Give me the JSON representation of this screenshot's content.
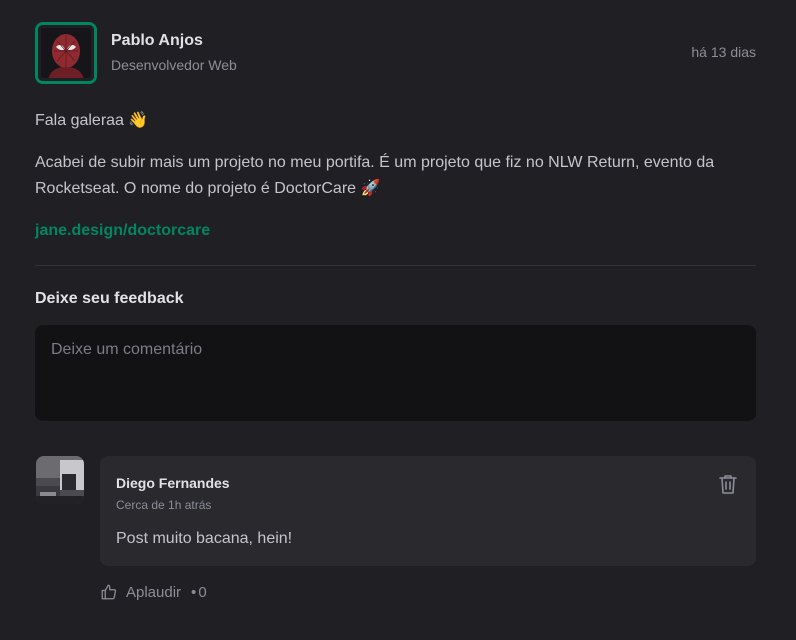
{
  "post": {
    "author": {
      "name": "Pablo Anjos",
      "role": "Desenvolvedor Web"
    },
    "time": "há 13 dias",
    "content": {
      "greeting": "Fala galeraa 👋",
      "body": "Acabei de subir mais um projeto no meu portifa. É um projeto que fiz no NLW Return, evento da Rocketseat. O nome do projeto é DoctorCare 🚀",
      "link": "jane.design/doctorcare"
    }
  },
  "feedback": {
    "title": "Deixe seu feedback",
    "placeholder": "Deixe um comentário"
  },
  "comment": {
    "author": "Diego Fernandes",
    "time": "Cerca de 1h atrás",
    "text": "Post muito bacana, hein!",
    "applaud_label": "Aplaudir",
    "applaud_separator": "•",
    "applaud_count": "0"
  },
  "colors": {
    "background": "#202024",
    "accent": "#00875f",
    "card": "#29292e",
    "input": "#121214"
  },
  "icons": {
    "delete": "trash-icon",
    "applaud": "thumbs-up-icon"
  }
}
